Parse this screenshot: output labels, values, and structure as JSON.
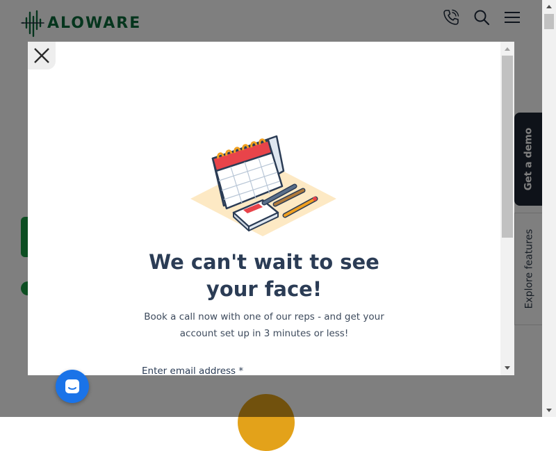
{
  "header": {
    "logo_text": "ALOWARE",
    "icons": [
      "phone-icon",
      "search-icon",
      "hamburger-menu-icon"
    ]
  },
  "side_tabs": {
    "demo_label": "Get a demo",
    "features_label": "Explore features"
  },
  "modal": {
    "title_line1": "We can't wait to see",
    "title_line2": "your face!",
    "desc_line1": "Book a call now with one of our reps - and get your",
    "desc_line2": "account set up in 3 minutes or less!",
    "email_label": "Enter email address *"
  },
  "colors": {
    "brand_green": "#0b6b3a",
    "title": "#2b3c55",
    "chat": "#1a73e8",
    "demo_tab": "#1c2533"
  }
}
